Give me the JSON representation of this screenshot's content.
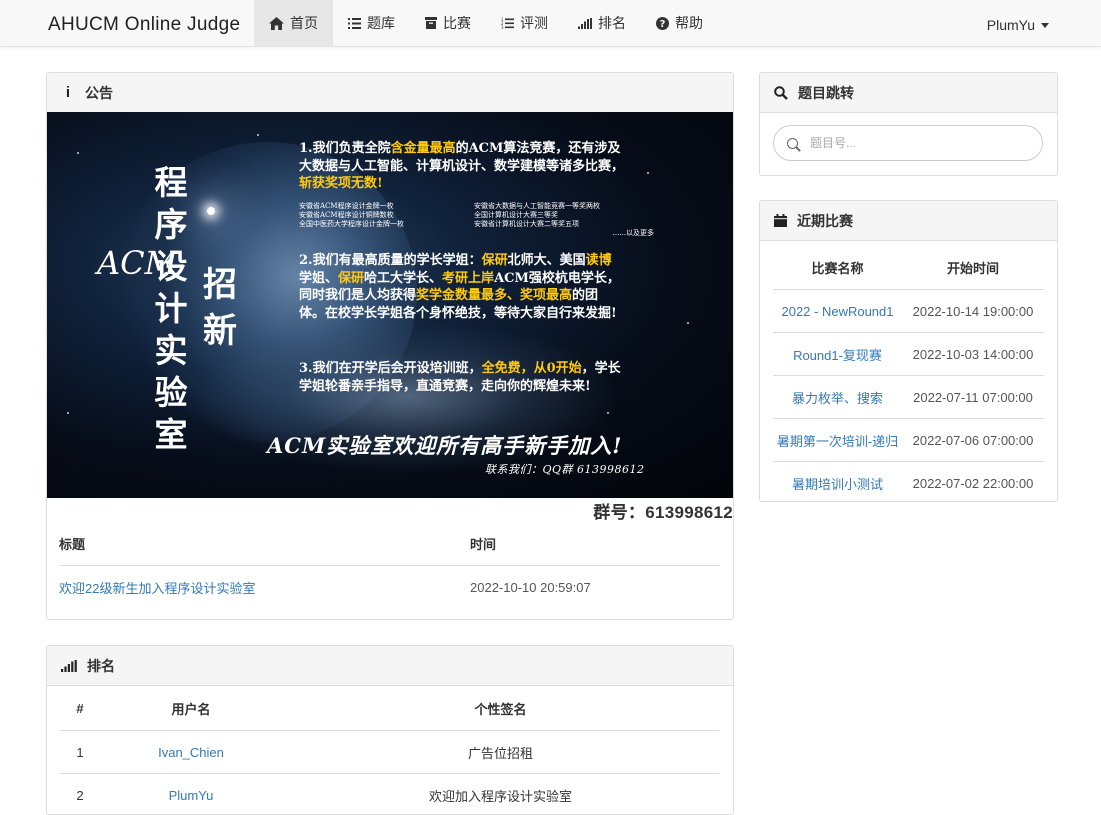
{
  "navbar": {
    "brand": "AHUCM Online Judge",
    "items": [
      {
        "label": "首页",
        "icon": "home-icon",
        "active": true
      },
      {
        "label": "题库",
        "icon": "list-icon",
        "active": false
      },
      {
        "label": "比赛",
        "icon": "archive-icon",
        "active": false
      },
      {
        "label": "评测",
        "icon": "list-ol-icon",
        "active": false
      },
      {
        "label": "排名",
        "icon": "signal-icon",
        "active": false
      },
      {
        "label": "帮助",
        "icon": "question-circle-icon",
        "active": false
      }
    ],
    "user": "PlumYu"
  },
  "announcement": {
    "title": "公告",
    "banner": {
      "acm_vertical": "ACM",
      "lab_vertical": "程序设计实验室",
      "recruit_vertical": "招新",
      "para1": [
        "1.我们负责全院",
        "含金量最高",
        "的ACM算法竞赛，还有涉及大数据与人工智能、计算机设计、数学建模等诸多比赛，",
        "斩获奖项无数!"
      ],
      "awards_left": [
        "安徽省ACM程序设计金牌一枚",
        "安徽省ACM程序设计铜牌数枚",
        "全国中医药大学程序设计金牌一枚"
      ],
      "awards_right": [
        "安徽省大数据与人工智能竞赛一等奖两枚",
        "全国计算机设计大赛三等奖",
        "安徽省计算机设计大赛二等奖五项"
      ],
      "awards_more": "......以及更多",
      "para2": [
        "2.我们有最高质量的学长学姐：",
        "保研",
        "北师大、美国",
        "读博",
        "学姐、",
        "保研",
        "哈工大学长、",
        "考研上岸",
        "ACM强校杭电学长，同时我们是人均获得",
        "奖学金数量最多、奖项最高",
        "的团体。在校学长学姐各个身怀绝技，等待大家自行来发掘!"
      ],
      "para3": [
        "3.我们在开学后会开设培训班，",
        "全免费，从0开始",
        "，学长学姐轮番亲手指导，直通竞赛，走向你的辉煌未来!"
      ],
      "welcome": "ACM实验室欢迎所有高手新手加入!",
      "contact": "联系我们：QQ群 613998612"
    },
    "group_number": "群号：613998612",
    "columns": [
      "标题",
      "时间"
    ],
    "rows": [
      {
        "title": "欢迎22级新生加入程序设计实验室",
        "time": "2022-10-10 20:59:07"
      }
    ]
  },
  "ranking": {
    "title": "排名",
    "columns": [
      "#",
      "用户名",
      "个性签名"
    ],
    "rows": [
      {
        "rank": "1",
        "user": "Ivan_Chien",
        "signature": "广告位招租"
      },
      {
        "rank": "2",
        "user": "PlumYu",
        "signature": "欢迎加入程序设计实验室"
      }
    ]
  },
  "problem_jump": {
    "title": "题目跳转",
    "placeholder": "题目号..."
  },
  "recent_contests": {
    "title": "近期比赛",
    "columns": [
      "比赛名称",
      "开始时间"
    ],
    "rows": [
      {
        "name": "2022 - NewRound1",
        "start": "2022-10-14 19:00:00"
      },
      {
        "name": "Round1-复现赛",
        "start": "2022-10-03 14:00:00"
      },
      {
        "name": "暴力枚举、搜索",
        "start": "2022-07-11 07:00:00"
      },
      {
        "name": "暑期第一次培训-递归",
        "start": "2022-07-06 07:00:00"
      },
      {
        "name": "暑期培训小测试",
        "start": "2022-07-02 22:00:00"
      }
    ]
  },
  "colors": {
    "link": "#337ab7",
    "highlight": "#ffc90e",
    "navbar_bg": "#f8f8f8",
    "panel_heading_bg": "#f5f5f5"
  }
}
